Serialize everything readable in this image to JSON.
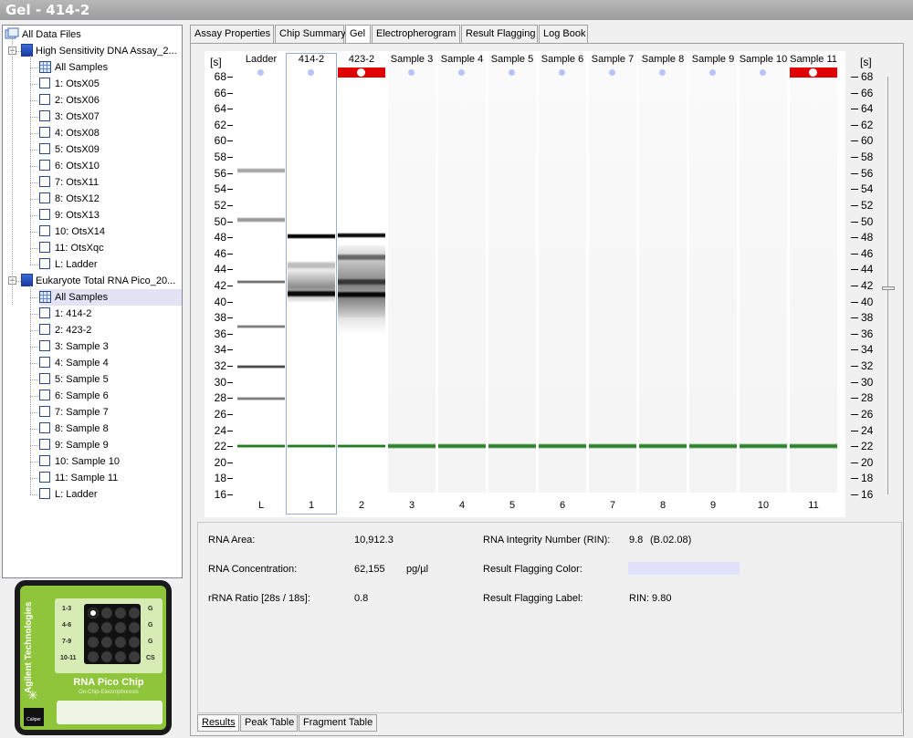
{
  "window": {
    "title": "Gel - 414-2"
  },
  "tree": {
    "root": "All Data Files",
    "assays": [
      {
        "name": "High Sensitivity DNA Assay_2...",
        "all_samples": "All Samples",
        "items": [
          "1: OtsX05",
          "2: OtsX06",
          "3: OtsX07",
          "4: OtsX08",
          "5: OtsX09",
          "6: OtsX10",
          "7: OtsX11",
          "8: OtsX12",
          "9: OtsX13",
          "10: OtsX14",
          "11: OtsXqc",
          "L: Ladder"
        ]
      },
      {
        "name": "Eukaryote Total RNA Pico_20...",
        "all_samples": "All Samples",
        "items": [
          "1: 414-2",
          "2: 423-2",
          "3: Sample 3",
          "4: Sample 4",
          "5: Sample 5",
          "6: Sample 6",
          "7: Sample 7",
          "8: Sample 8",
          "9: Sample 9",
          "10: Sample 10",
          "11: Sample 11",
          "L: Ladder"
        ]
      }
    ]
  },
  "chip": {
    "brand": "Agilent Technologies",
    "name": "RNA Pico Chip",
    "subtitle": "On-Chip-Electrophoresis",
    "row_labels": [
      "1-3",
      "4-6",
      "7-9",
      "10-11"
    ],
    "right_labels": [
      "G",
      "G",
      "G",
      "CS"
    ],
    "logo": "Caliper"
  },
  "tabs": [
    "Assay Properties",
    "Chip Summary",
    "Gel",
    "Electropherogram",
    "Result Flagging",
    "Log Book"
  ],
  "gel": {
    "axis_unit": "[s]",
    "ticks": [
      68,
      66,
      64,
      62,
      60,
      58,
      56,
      54,
      52,
      50,
      48,
      46,
      44,
      42,
      40,
      38,
      36,
      34,
      32,
      30,
      28,
      26,
      24,
      22,
      20,
      18,
      16
    ],
    "lanes": [
      {
        "name": "Ladder",
        "num": "L",
        "flag": false,
        "dot": true
      },
      {
        "name": "414-2",
        "num": "1",
        "flag": false,
        "dot": true
      },
      {
        "name": "423-2",
        "num": "2",
        "flag": true,
        "dot": true
      },
      {
        "name": "Sample 3",
        "num": "3",
        "flag": false,
        "dot": true
      },
      {
        "name": "Sample 4",
        "num": "4",
        "flag": false,
        "dot": true
      },
      {
        "name": "Sample 5",
        "num": "5",
        "flag": false,
        "dot": true
      },
      {
        "name": "Sample 6",
        "num": "6",
        "flag": false,
        "dot": true
      },
      {
        "name": "Sample 7",
        "num": "7",
        "flag": false,
        "dot": true
      },
      {
        "name": "Sample 8",
        "num": "8",
        "flag": false,
        "dot": true
      },
      {
        "name": "Sample 9",
        "num": "9",
        "flag": false,
        "dot": true
      },
      {
        "name": "Sample 10",
        "num": "10",
        "flag": false,
        "dot": true
      },
      {
        "name": "Sample 11",
        "num": "11",
        "flag": true,
        "dot": true
      }
    ],
    "selected_lane": 1,
    "bands": {
      "ladder": [
        [
          56.3,
          0.35,
          3
        ],
        [
          50.2,
          0.4,
          3
        ],
        [
          42.4,
          0.55,
          2
        ],
        [
          36.9,
          0.5,
          2
        ],
        [
          31.9,
          0.7,
          2
        ],
        [
          27.9,
          0.5,
          2
        ],
        [
          22.0,
          0.9,
          2
        ]
      ],
      "sample_414": [
        [
          48.1,
          1.0,
          3
        ],
        [
          44.5,
          0.25,
          5
        ],
        [
          41.0,
          0.95,
          4
        ],
        [
          22.0,
          0.9,
          2
        ]
      ],
      "sample_423": [
        [
          48.2,
          0.95,
          3
        ],
        [
          45.5,
          0.5,
          4
        ],
        [
          42.5,
          0.6,
          4
        ],
        [
          40.9,
          0.95,
          4
        ],
        [
          22.0,
          0.9,
          2
        ]
      ],
      "empty": [
        [
          22.0,
          0.85,
          3
        ]
      ]
    }
  },
  "results": {
    "rna_area_label": "RNA Area:",
    "rna_area_value": "10,912.3",
    "rna_conc_label": "RNA Concentration:",
    "rna_conc_value": "62,155",
    "rna_conc_unit": "pg/µl",
    "rrna_label": "rRNA Ratio [28s / 18s]:",
    "rrna_value": "0.8",
    "rin_label": "RNA Integrity Number (RIN):",
    "rin_value": "9.8",
    "rin_version": "(B.02.08)",
    "flag_color_label": "Result Flagging Color:",
    "flag_color": "#e0e0fa",
    "flag_label_label": "Result Flagging Label:",
    "flag_label_value": "RIN: 9.80"
  },
  "bottom_tabs": [
    "Results",
    "Peak Table",
    "Fragment Table"
  ]
}
